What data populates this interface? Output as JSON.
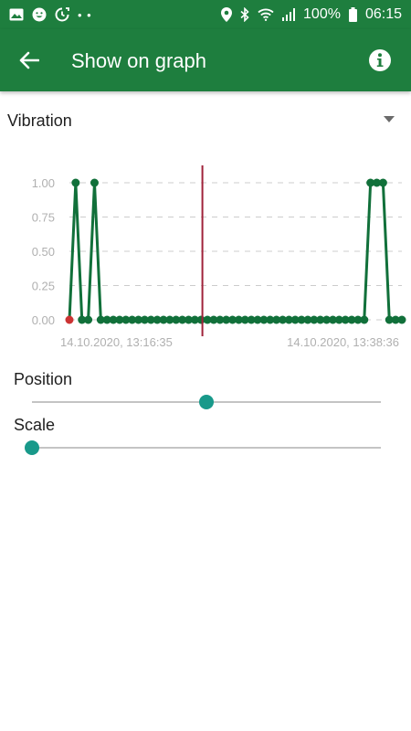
{
  "status_bar": {
    "battery_text": "100%",
    "time": "06:15",
    "left_icons": [
      "image-icon",
      "emoji-icon",
      "sync-icon",
      "more-dots-icon"
    ],
    "right_icons": [
      "location-icon",
      "bluetooth-icon",
      "wifi-icon",
      "signal-icon",
      "battery-icon"
    ]
  },
  "app_bar": {
    "title": "Show on graph",
    "back_icon": "arrow-back-icon",
    "info_icon": "info-icon"
  },
  "colors": {
    "primary": "#1e7e3e",
    "series": "#11703a",
    "marker": "#a0223a",
    "start_point": "#cc3333",
    "thumb": "#18998a"
  },
  "dropdown": {
    "selected": "Vibration",
    "icon": "dropdown-arrow-icon"
  },
  "chart_data": {
    "type": "line",
    "y_ticks": [
      "1.00",
      "0.75",
      "0.50",
      "0.25",
      "0.00"
    ],
    "ylim": [
      0,
      1
    ],
    "x_start_label": "14.10.2020, 13:16:35",
    "x_end_label": "14.10.2020, 13:38:36",
    "grid": "horizontal dashed",
    "marker_position": 0.4,
    "series": [
      {
        "values": [
          0,
          1,
          0,
          0,
          1,
          0,
          0,
          0,
          0,
          0,
          0,
          0,
          0,
          0,
          0,
          0,
          0,
          0,
          0,
          0,
          0,
          0,
          0,
          0,
          0,
          0,
          0,
          0,
          0,
          0,
          0,
          0,
          0,
          0,
          0,
          0,
          0,
          0,
          0,
          0,
          0,
          0,
          0,
          0,
          0,
          0,
          0,
          0,
          1,
          1,
          1,
          0,
          0,
          0
        ]
      }
    ]
  },
  "sliders": {
    "position": {
      "label": "Position",
      "value": 0.5
    },
    "scale": {
      "label": "Scale",
      "value": 0.0
    }
  }
}
